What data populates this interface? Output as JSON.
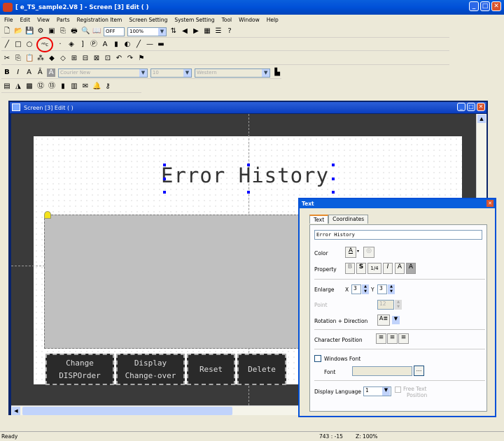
{
  "app": {
    "title": "[ e_TS_sample2.V8 ] - Screen [3] Edit (                  )"
  },
  "menu": [
    "File",
    "Edit",
    "View",
    "Parts",
    "Registration Item",
    "Screen Setting",
    "System Setting",
    "Tool",
    "Window",
    "Help"
  ],
  "toolbar": {
    "off_label": "OFF",
    "zoom": "100%",
    "font_name": "Courier New",
    "font_size": "10",
    "charset": "Western"
  },
  "inner": {
    "title": "Screen [3] Edit (                )"
  },
  "canvas": {
    "heading": "Error History",
    "buttons": [
      {
        "l1": "Change",
        "l2": "DISPOrder"
      },
      {
        "l1": "Display",
        "l2": "Change-over"
      },
      {
        "l1": "Reset",
        "l2": ""
      },
      {
        "l1": "Delete",
        "l2": ""
      }
    ]
  },
  "status": {
    "ready": "Ready",
    "coords": "743 : -15",
    "zoom": "Z: 100%"
  },
  "dialog": {
    "title": "Text",
    "tab_text": "Text",
    "tab_coords": "Coordinates",
    "text_value": "Error History",
    "color": "Color",
    "property": "Property",
    "enlarge": "Enlarge",
    "x": "X",
    "y": "Y",
    "x_val": "3",
    "y_val": "3",
    "point": "Point",
    "point_val": "12",
    "rotation": "Rotation + Direction",
    "char_pos": "Character Position",
    "win_font": "Windows Font",
    "font": "Font",
    "disp_lang": "Display Language",
    "disp_lang_val": "1",
    "free_text": "Free Text",
    "position": "Position",
    "prop_fraction": "1/4"
  }
}
